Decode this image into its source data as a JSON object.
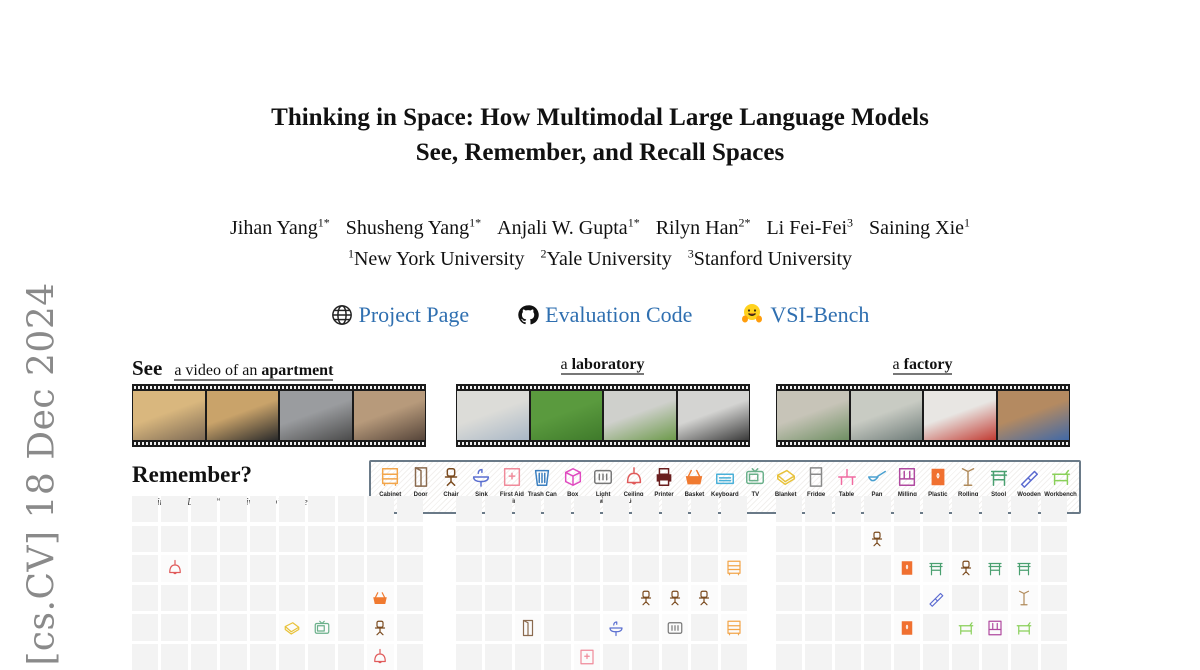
{
  "arxiv_stamp": "[cs.CV]  18 Dec 2024",
  "title": {
    "line1": "Thinking in Space: How Multimodal Large Language Models",
    "line2": "See, Remember, and Recall Spaces"
  },
  "authors": [
    {
      "name": "Jihan Yang",
      "sup": "1*"
    },
    {
      "name": "Shusheng Yang",
      "sup": "1*"
    },
    {
      "name": "Anjali W. Gupta",
      "sup": "1*"
    },
    {
      "name": "Rilyn Han",
      "sup": "2*"
    },
    {
      "name": "Li Fei-Fei",
      "sup": "3"
    },
    {
      "name": "Saining Xie",
      "sup": "1"
    }
  ],
  "affiliations": [
    {
      "sup": "1",
      "name": "New York University"
    },
    {
      "sup": "2",
      "name": "Yale University"
    },
    {
      "sup": "3",
      "name": "Stanford University"
    }
  ],
  "links": [
    {
      "icon": "globe-icon",
      "label": "Project Page"
    },
    {
      "icon": "github-icon",
      "label": "Evaluation Code"
    },
    {
      "icon": "hugging-face-icon",
      "label": "VSI-Bench"
    }
  ],
  "colors": {
    "link": "#2f6fb0",
    "cell": "#f3f3f3"
  },
  "see": {
    "heading": "See",
    "scenes": [
      {
        "prefix": "a video of an ",
        "name": "apartment",
        "frames": [
          [
            "#d9b77e",
            "#7d6a55"
          ],
          [
            "#c9a36a",
            "#2b2b2b"
          ],
          [
            "#9a9c9f",
            "#4b4b4b"
          ],
          [
            "#b79a7b",
            "#56453a"
          ]
        ]
      },
      {
        "prefix": "a ",
        "name": "laboratory",
        "frames": [
          [
            "#dcdcd8",
            "#a9b7c6"
          ],
          [
            "#5a9a3e",
            "#3f7a2b"
          ],
          [
            "#cfd0cc",
            "#6d9a4b"
          ],
          [
            "#d4d4d2",
            "#3a3a3a"
          ]
        ]
      },
      {
        "prefix": "a ",
        "name": "factory",
        "frames": [
          [
            "#c7c4b8",
            "#6f8f63"
          ],
          [
            "#c8cbc3",
            "#6e7b78"
          ],
          [
            "#e8e6e3",
            "#c23b32"
          ],
          [
            "#b48a61",
            "#4169a7"
          ]
        ]
      }
    ]
  },
  "remember": {
    "heading": "Remember?",
    "subtitle": "Multimodal LLM's “cognitive map” of the space"
  },
  "legend": [
    {
      "key": "cabinet",
      "label": "Cabinet",
      "color": "#f2a54a"
    },
    {
      "key": "door",
      "label": "Door",
      "color": "#8a6a4e"
    },
    {
      "key": "chair",
      "label": "Chair",
      "color": "#7a4a1e"
    },
    {
      "key": "sink",
      "label": "Sink",
      "color": "#5b6fd0"
    },
    {
      "key": "first-aid-cabinet",
      "label": "First Aid Cabinet",
      "color": "#f08a9a"
    },
    {
      "key": "trash-can",
      "label": "Trash Can",
      "color": "#3b7fc0"
    },
    {
      "key": "box",
      "label": "Box",
      "color": "#e04ac0"
    },
    {
      "key": "light-switch",
      "label": "Light Switch",
      "color": "#777777"
    },
    {
      "key": "ceiling-light",
      "label": "Ceiling Light",
      "color": "#e05a5a"
    },
    {
      "key": "printer",
      "label": "Printer",
      "color": "#6a1e1e"
    },
    {
      "key": "basket",
      "label": "Basket",
      "color": "#f07a30"
    },
    {
      "key": "keyboard",
      "label": "Keyboard",
      "color": "#4ab0d8"
    },
    {
      "key": "tv",
      "label": "TV",
      "color": "#6ab08a"
    },
    {
      "key": "blanket",
      "label": "Blanket",
      "color": "#e8c23a"
    },
    {
      "key": "fridge",
      "label": "Fridge",
      "color": "#8a8a8a"
    },
    {
      "key": "table",
      "label": "Table",
      "color": "#f06aa0"
    },
    {
      "key": "pan",
      "label": "Pan",
      "color": "#4aa0d0"
    },
    {
      "key": "milling-machine",
      "label": "Milling Machine",
      "color": "#b04aa0"
    },
    {
      "key": "plastic-drum",
      "label": "Plastic Drum",
      "color": "#f07030"
    },
    {
      "key": "rolling-stand",
      "label": "Rolling Stand",
      "color": "#b08a5a"
    },
    {
      "key": "stool",
      "label": "Stool",
      "color": "#4aa070"
    },
    {
      "key": "wooden-brush",
      "label": "Wooden Brush",
      "color": "#5a6ad0"
    },
    {
      "key": "workbench",
      "label": "Workbench",
      "color": "#8ad05a"
    }
  ],
  "maps": [
    {
      "scene": "apartment",
      "rows": [
        [
          "",
          "",
          "",
          "",
          "",
          "",
          "",
          "",
          "",
          ""
        ],
        [
          "",
          "",
          "",
          "",
          "",
          "",
          "",
          "",
          "",
          ""
        ],
        [
          "",
          "ceiling-light",
          "",
          "",
          "",
          "",
          "",
          "",
          "",
          ""
        ],
        [
          "",
          "",
          "",
          "",
          "",
          "",
          "",
          "",
          "basket",
          ""
        ],
        [
          "",
          "",
          "",
          "",
          "",
          "blanket",
          "tv",
          "",
          "chair",
          ""
        ],
        [
          "",
          "",
          "",
          "",
          "",
          "",
          "",
          "",
          "ceiling-light",
          ""
        ]
      ]
    },
    {
      "scene": "laboratory",
      "rows": [
        [
          "",
          "",
          "",
          "",
          "",
          "",
          "",
          "",
          "",
          ""
        ],
        [
          "",
          "",
          "",
          "",
          "",
          "",
          "",
          "",
          "",
          ""
        ],
        [
          "",
          "",
          "",
          "",
          "",
          "",
          "",
          "",
          "",
          "cabinet"
        ],
        [
          "",
          "",
          "",
          "",
          "",
          "",
          "chair",
          "chair",
          "chair",
          ""
        ],
        [
          "",
          "",
          "door",
          "",
          "",
          "sink",
          "",
          "light-switch",
          "",
          "cabinet"
        ],
        [
          "",
          "",
          "",
          "",
          "first-aid-cabinet",
          "",
          "",
          "",
          "",
          ""
        ]
      ]
    },
    {
      "scene": "factory",
      "rows": [
        [
          "",
          "",
          "",
          "",
          "",
          "",
          "",
          "",
          "",
          ""
        ],
        [
          "",
          "",
          "",
          "chair",
          "",
          "",
          "",
          "",
          "",
          ""
        ],
        [
          "",
          "",
          "",
          "",
          "plastic-drum",
          "stool",
          "chair",
          "stool",
          "stool",
          ""
        ],
        [
          "",
          "",
          "",
          "",
          "",
          "wooden-brush",
          "",
          "",
          "rolling-stand",
          ""
        ],
        [
          "",
          "",
          "",
          "",
          "plastic-drum",
          "",
          "workbench",
          "milling-machine",
          "workbench",
          ""
        ],
        [
          "",
          "",
          "",
          "",
          "",
          "",
          "",
          "",
          "",
          ""
        ]
      ]
    }
  ]
}
